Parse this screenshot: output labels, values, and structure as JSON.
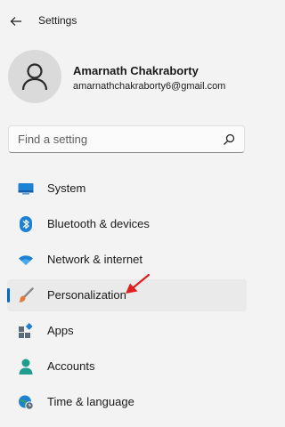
{
  "window": {
    "title": "Settings"
  },
  "icons": {
    "back": "back-arrow-icon",
    "avatar": "user-avatar-icon",
    "search": "search-icon"
  },
  "profile": {
    "name": "Amarnath Chakraborty",
    "email": "amarnathchakraborty6@gmail.com"
  },
  "search": {
    "placeholder": "Find a setting",
    "value": ""
  },
  "nav": {
    "items": [
      {
        "label": "System",
        "icon": "monitor-icon",
        "selected": false
      },
      {
        "label": "Bluetooth & devices",
        "icon": "bluetooth-icon",
        "selected": false
      },
      {
        "label": "Network & internet",
        "icon": "wifi-icon",
        "selected": false
      },
      {
        "label": "Personalization",
        "icon": "brush-icon",
        "selected": true
      },
      {
        "label": "Apps",
        "icon": "apps-icon",
        "selected": false
      },
      {
        "label": "Accounts",
        "icon": "person-icon",
        "selected": false
      },
      {
        "label": "Time & language",
        "icon": "globe-clock-icon",
        "selected": false
      }
    ]
  },
  "colors": {
    "accent": "#0067c0",
    "background": "#f3f3f3",
    "selected_background": "#eaeaea",
    "annotation_arrow": "#e02020"
  }
}
